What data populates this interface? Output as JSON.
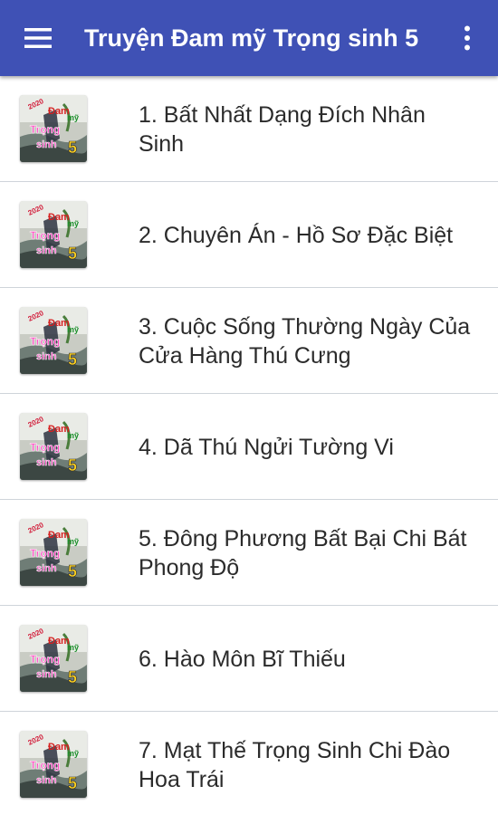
{
  "app_bar": {
    "title": "Truyện Đam mỹ Trọng sinh 5",
    "color": "#3f51b5",
    "left_icon": "menu-icon",
    "right_icon": "more-vert-icon"
  },
  "thumbnail": {
    "year": "2020",
    "line1": "Đam",
    "line2": "mỹ",
    "line3": "Trọng",
    "line4": "sinh",
    "number": "5"
  },
  "stories": [
    {
      "label": "1. Bất Nhất Dạng Đích Nhân Sinh"
    },
    {
      "label": "2. Chuyên Án - Hồ Sơ Đặc Biệt"
    },
    {
      "label": "3. Cuộc Sống Thường Ngày Của Cửa Hàng Thú Cưng"
    },
    {
      "label": "4. Dã Thú Ngửi Tường Vi"
    },
    {
      "label": "5. Đông Phương Bất Bại Chi Bát Phong Độ"
    },
    {
      "label": "6. Hào Môn Bĩ Thiếu"
    },
    {
      "label": "7. Mạt Thế Trọng Sinh Chi Đào Hoa Trái"
    }
  ]
}
